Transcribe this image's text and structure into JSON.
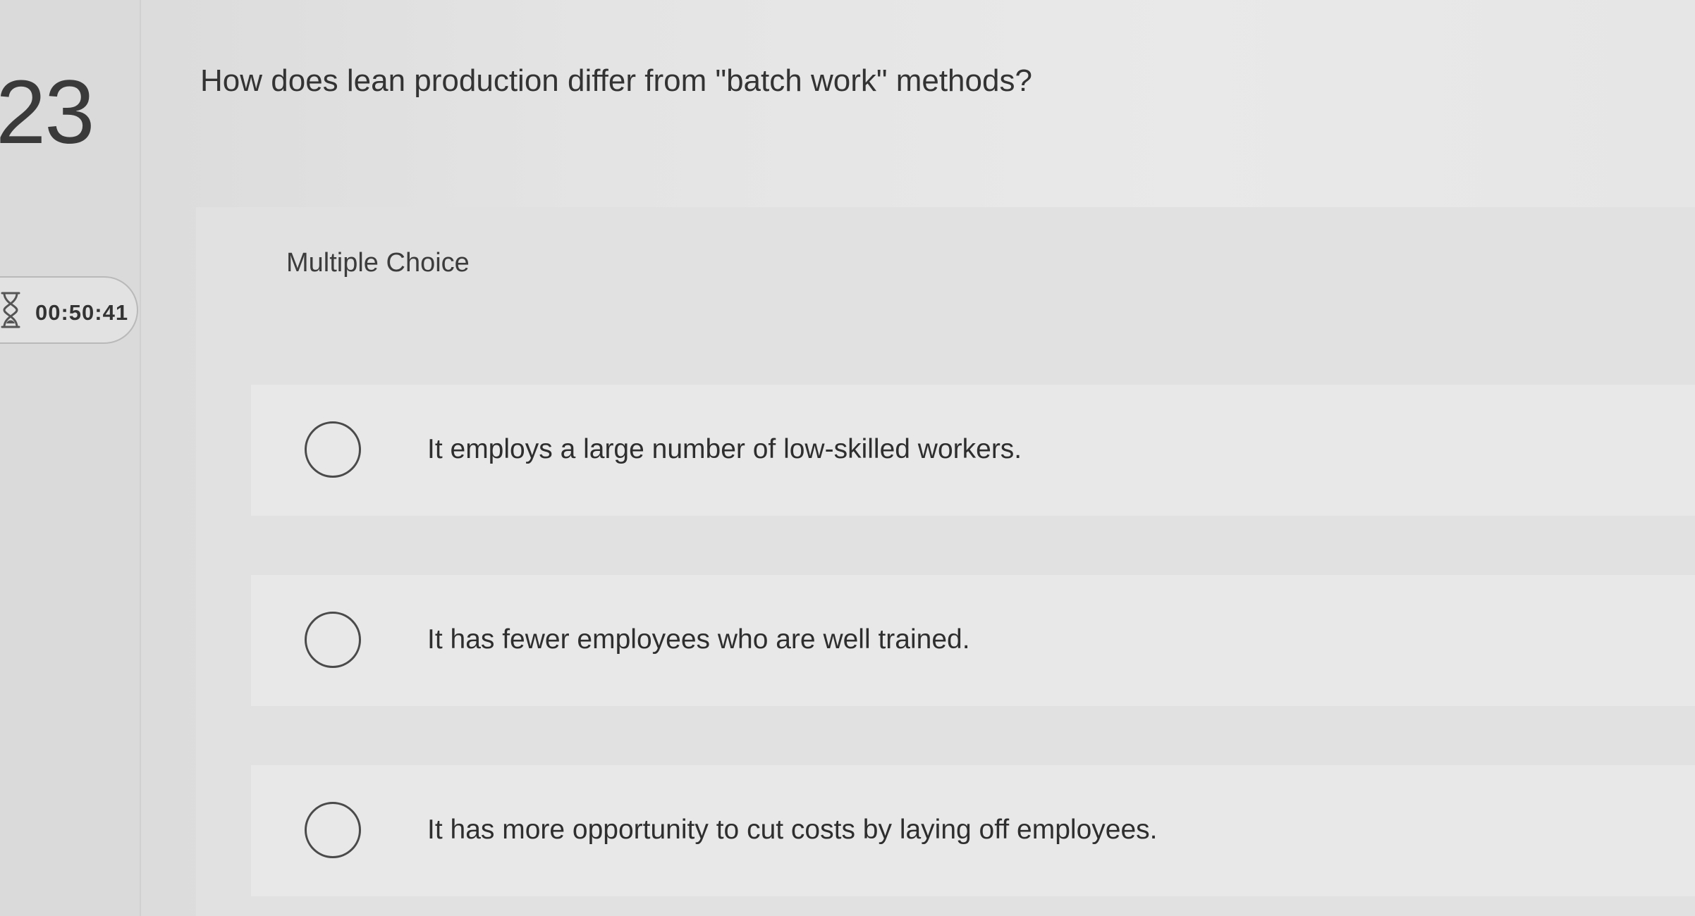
{
  "question": {
    "number": "23",
    "text": "How does lean production differ from \"batch work\" methods?",
    "type_label": "Multiple Choice"
  },
  "timer": {
    "icon": "hourglass-icon",
    "value": "00:50:41"
  },
  "choices": [
    {
      "label": "It employs a large number of low-skilled workers.",
      "selected": false
    },
    {
      "label": "It has fewer employees who are well trained.",
      "selected": false
    },
    {
      "label": "It has more opportunity to cut costs by laying off employees.",
      "selected": false
    }
  ]
}
